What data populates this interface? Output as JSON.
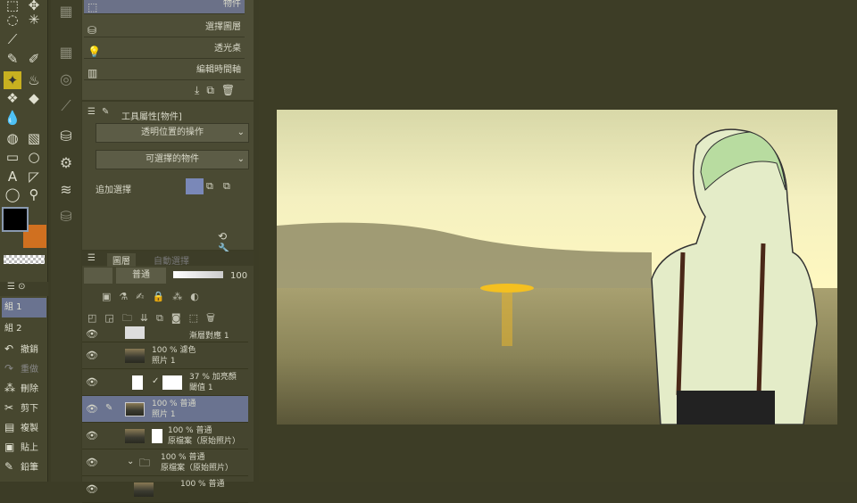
{
  "toolbox": {
    "fg_color": "#000000",
    "bg_color": "#d07020",
    "tools": [
      "move-icon",
      "select-icon",
      "lasso-icon",
      "magic-wand-icon",
      "eyedropper-icon",
      "pen-icon",
      "pencil-icon",
      "brush-icon",
      "fill-icon",
      "airbrush-icon",
      "decoration-icon",
      "eraser-icon",
      "blend-icon",
      "fill-bucket-icon",
      "gradient-icon",
      "frame-icon",
      "ellipse-icon",
      "text-icon",
      "ruler-icon",
      "balloon-icon",
      "correction-icon"
    ]
  },
  "sets": {
    "items": [
      {
        "label": "組 1",
        "selected": true
      },
      {
        "label": "組 2",
        "selected": false
      }
    ]
  },
  "commands": {
    "undo": "撤銷",
    "redo": "重做",
    "delete": "刪除",
    "cut": "剪下",
    "copy": "複製",
    "paste": "貼上",
    "pencil": "鉛筆"
  },
  "subtool": {
    "items": [
      {
        "label": "物件",
        "selected": true
      },
      {
        "label": "選擇圖層"
      },
      {
        "label": "透光桌"
      },
      {
        "label": "編輯時間軸"
      }
    ]
  },
  "tool_property": {
    "title": "工具屬性[物件]",
    "dropdown1": "透明位置的操作",
    "dropdown2": "可選擇的物件",
    "add_selection_label": "追加選擇"
  },
  "layers": {
    "tab_layer": "圖層",
    "tab_other": "自動選擇",
    "blend_mode": "普通",
    "opacity": "100",
    "rows": [
      {
        "line1": "",
        "line2": "漸層對應 1",
        "selected": false
      },
      {
        "line1": "100 %  濾色",
        "line2": "照片 1",
        "selected": false
      },
      {
        "line1": "37 %  加亮顏",
        "line2": "閾值 1",
        "selected": false
      },
      {
        "line1": "100 %  普通",
        "line2": "照片 1",
        "selected": true
      },
      {
        "line1": "100 %  普通",
        "line2": "原檔案（原始照片）",
        "selected": false
      },
      {
        "line1": "100 %  普通",
        "line2": "原檔案（原始照片）",
        "selected": false
      },
      {
        "line1": "100 %  普通",
        "line2": "",
        "selected": false
      }
    ]
  }
}
